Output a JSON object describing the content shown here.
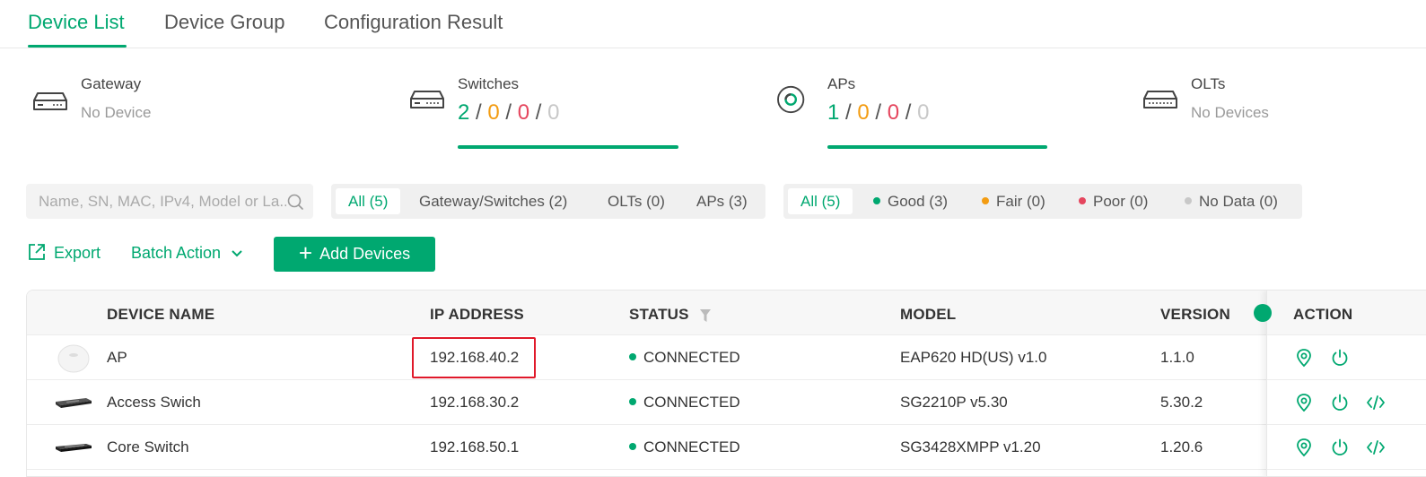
{
  "tabs": [
    {
      "label": "Device List",
      "active": true
    },
    {
      "label": "Device Group",
      "active": false
    },
    {
      "label": "Configuration Result",
      "active": false
    }
  ],
  "summary": {
    "gateway": {
      "title": "Gateway",
      "sub": "No Device",
      "icon": "gateway-icon"
    },
    "switches": {
      "title": "Switches",
      "good": "2",
      "fair": "0",
      "poor": "0",
      "none": "0",
      "sep": "/",
      "icon": "switch-icon"
    },
    "aps": {
      "title": "APs",
      "good": "1",
      "fair": "0",
      "poor": "0",
      "none": "0",
      "sep": "/",
      "icon": "ap-icon"
    },
    "olts": {
      "title": "OLTs",
      "sub": "No Devices",
      "icon": "olt-icon"
    }
  },
  "search": {
    "placeholder": "Name, SN, MAC, IPv4, Model or La..."
  },
  "type_filter": [
    "All (5)",
    "Gateway/Switches (2)",
    "OLTs (0)",
    "APs (3)"
  ],
  "health_filter": [
    "All (5)",
    "Good (3)",
    "Fair (0)",
    "Poor (0)",
    "No Data (0)"
  ],
  "actions": {
    "export": "Export",
    "batch": "Batch Action",
    "add": "Add Devices"
  },
  "table": {
    "headers": {
      "name": "DEVICE NAME",
      "ip": "IP ADDRESS",
      "status": "STATUS",
      "model": "MODEL",
      "version": "VERSION",
      "action": "ACTION"
    },
    "rows": [
      {
        "name": "AP",
        "ip": "192.168.40.2",
        "status": "CONNECTED",
        "model": "EAP620 HD(US) v1.0",
        "version": "1.1.0"
      },
      {
        "name": "Access Swich",
        "ip": "192.168.30.2",
        "status": "CONNECTED",
        "model": "SG2210P v5.30",
        "version": "5.30.2"
      },
      {
        "name": "Core Switch",
        "ip": "192.168.50.1",
        "status": "CONNECTED",
        "model": "SG3428XMPP v1.20",
        "version": "1.20.6"
      }
    ]
  },
  "colors": {
    "accent": "#00a870",
    "good": "#00a870",
    "fair": "#f39c12",
    "poor": "#e5465e",
    "none": "#c8c8c8",
    "highlight": "#e0192a"
  }
}
